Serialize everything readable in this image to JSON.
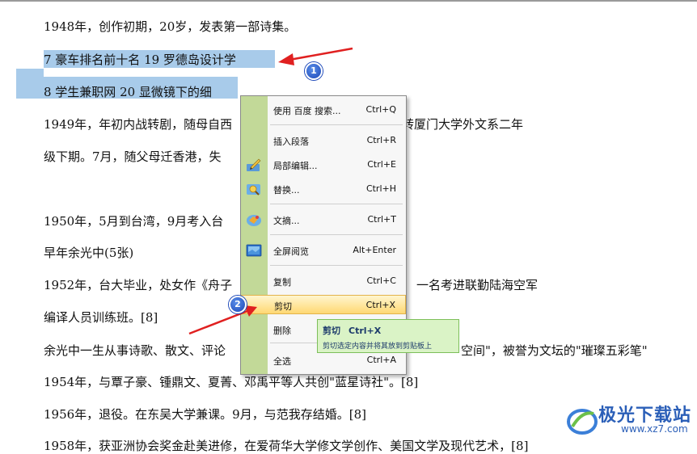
{
  "document": {
    "lines": [
      "1948年，创作初期，20岁，发表第一部诗集。",
      "7 豪车排名前十名 19 罗德岛设计学",
      "8 学生兼职网 20 显微镜下的细",
      "1949年，年初内战转剧，随母自西",
      "转厦门大学外文系二年",
      "级下期。7月，随父母迁香港，失",
      "1950年，5月到台湾，9月考入台",
      "早年余光中(5张)",
      "1952年，台大毕业，处女作《舟子",
      "一名考进联勤陆海空军",
      "编译人员训练班。[8]",
      "余光中一生从事诗歌、散文、评论",
      "空间\"，被誉为文坛的\"璀璨五彩笔\"",
      "1954年，与覃子豪、锺鼎文、夏菁、邓禹平等人共创\"蓝星诗社\"。[8]",
      "1956年，退役。在东吴大学兼课。9月，与范我存结婚。[8]",
      "1958年，获亚洲协会奖金赴美进修，在爱荷华大学修文学创作、美国文学及现代艺术，[8]"
    ]
  },
  "context_menu": {
    "items": [
      {
        "label": "使用 百度 搜索...",
        "shortcut": "Ctrl+Q",
        "icon": "none"
      },
      {
        "label": "插入段落",
        "shortcut": "Ctrl+R",
        "icon": "none"
      },
      {
        "label": "局部编辑...",
        "shortcut": "Ctrl+E",
        "icon": "edit-pen-icon"
      },
      {
        "label": "替换...",
        "shortcut": "Ctrl+H",
        "icon": "replace-icon"
      },
      {
        "label": "文摘...",
        "shortcut": "Ctrl+T",
        "icon": "excerpt-icon"
      },
      {
        "label": "全屏阅览",
        "shortcut": "Alt+Enter",
        "icon": "fullscreen-icon"
      },
      {
        "label": "复制",
        "shortcut": "Ctrl+C",
        "icon": "none"
      },
      {
        "label": "剪切",
        "shortcut": "Ctrl+X",
        "icon": "none"
      },
      {
        "label": "删除",
        "shortcut": "",
        "icon": "none"
      },
      {
        "label": "全选",
        "shortcut": "Ctrl+A",
        "icon": "none"
      }
    ],
    "highlighted": "剪切"
  },
  "tooltip": {
    "title": "剪切",
    "shortcut": "Ctrl+X",
    "description": "剪切选定内容并将其放到剪贴板上"
  },
  "annotations": {
    "badge1": "1",
    "badge2": "2",
    "arrow_color": "#e02020"
  },
  "watermark": {
    "text": "极光下载站",
    "url": "www.xz7.com"
  },
  "colors": {
    "selection": "#a8cbea",
    "menu_gutter": "#c2d998",
    "tooltip_bg": "#daf3c6",
    "highlight": "#ffd873"
  }
}
